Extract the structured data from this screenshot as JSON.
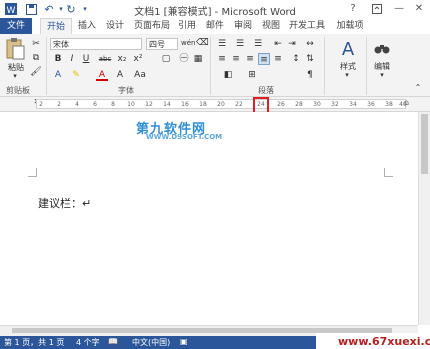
{
  "title_bar": {
    "title": "文档1 [兼容模式] - Microsoft Word",
    "help": "?",
    "minimize": "—",
    "close": "✕"
  },
  "tabs": [
    "文件",
    "开始",
    "插入",
    "设计",
    "页面布局",
    "引用",
    "邮件",
    "审阅",
    "视图",
    "开发工具",
    "加载项"
  ],
  "ribbon": {
    "paste_label": "粘贴",
    "font_name": "宋体",
    "font_size": "四号",
    "phonetic": "wén",
    "bold": "B",
    "italic": "I",
    "underline": "U",
    "strike": "abc",
    "subscript": "x₂",
    "superscript": "x²",
    "font_color": "A",
    "grow": "A",
    "change_case": "Aa",
    "styles_label": "样式",
    "editing_label": "编辑",
    "groups": {
      "clipboard": "剪贴板",
      "font": "字体",
      "paragraph": "段落"
    }
  },
  "ruler": {
    "ticks": [
      "2",
      "2",
      "4",
      "6",
      "8",
      "10",
      "12",
      "14",
      "16",
      "18",
      "20",
      "22",
      "24",
      "26",
      "28",
      "30",
      "32",
      "34",
      "36",
      "38",
      "40"
    ]
  },
  "document": {
    "watermark": "第九软件网",
    "watermark_url": "WWW.D9SOFT.COM",
    "body_text": "建议栏：↵"
  },
  "status_bar": {
    "page": "第 1 页，共 1 页",
    "words": "4 个字",
    "language": "中文(中国)"
  },
  "site_watermark": "www.67xuexi.com",
  "colors": {
    "accent": "#2b579a",
    "highlight": "#e02020",
    "watermark": "#2f8fd8"
  }
}
